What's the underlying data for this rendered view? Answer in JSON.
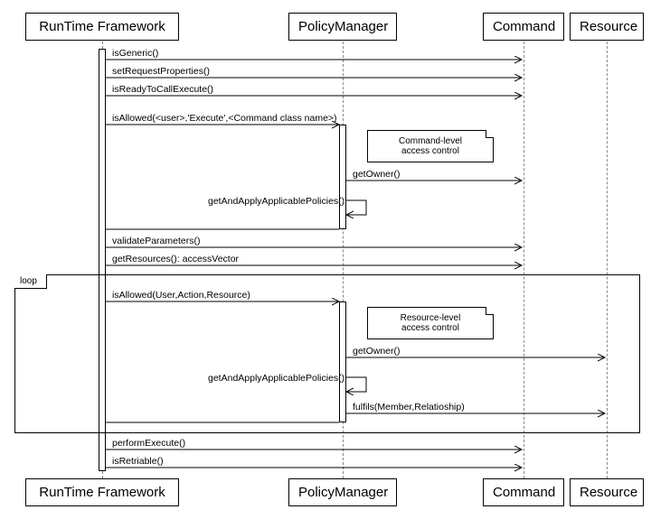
{
  "participants": {
    "runtime": "RunTime Framework",
    "policy": "PolicyManager",
    "command": "Command",
    "resource": "Resource"
  },
  "messages": {
    "m1": "isGeneric()",
    "m2": "setRequestProperties()",
    "m3": "isReadyToCallExecute()",
    "m4": "isAllowed(<user>,'Execute',<Command class name>)",
    "m5": "getOwner()",
    "m6": "getAndApplyApplicablePolicies()",
    "m7": "validateParameters()",
    "m8": "getResources(): accessVector",
    "m9": "isAllowed(User,Action,Resource)",
    "m10": "getOwner()",
    "m11": "getAndApplyApplicablePolicies()",
    "m12": "fulfils(Member,Relatioship)",
    "m13": "performExecute()",
    "m14": "isRetriable()"
  },
  "notes": {
    "n1_line1": "Command-level",
    "n1_line2": "access control",
    "n2_line1": "Resource-level",
    "n2_line2": "access control"
  },
  "frame": {
    "loop": "loop"
  }
}
